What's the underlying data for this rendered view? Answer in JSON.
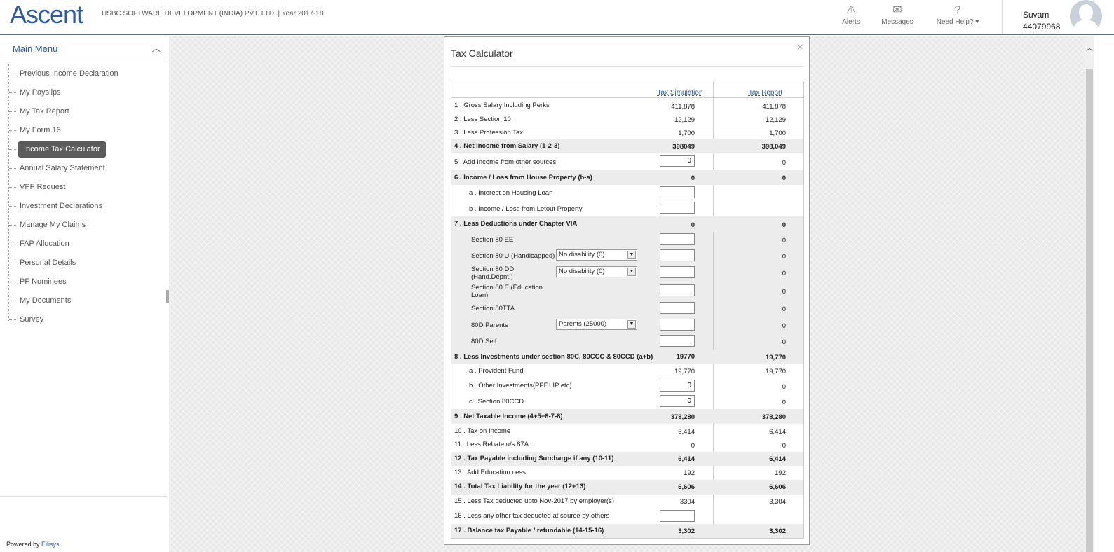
{
  "header": {
    "logo": "Ascent",
    "company": "HSBC SOFTWARE DEVELOPMENT (INDIA) PVT. LTD. | Year 2017-18",
    "alerts_label": "Alerts",
    "messages_label": "Messages",
    "help_label": "Need Help? ▾",
    "user_name": "Suvam",
    "user_id": "44079968",
    "icons": [
      "warning-icon",
      "mail-icon",
      "question-icon",
      "avatar-icon"
    ]
  },
  "sidebar": {
    "title": "Main Menu",
    "items": [
      {
        "label": "Previous Income Declaration"
      },
      {
        "label": "My Payslips"
      },
      {
        "label": "My Tax Report"
      },
      {
        "label": "My Form 16"
      },
      {
        "label": "Income Tax Calculator",
        "active": true
      },
      {
        "label": "Annual Salary Statement"
      },
      {
        "label": "VPF Request"
      },
      {
        "label": "Investment Declarations"
      },
      {
        "label": "Manage My Claims"
      },
      {
        "label": "FAP Allocation"
      },
      {
        "label": "Personal Details"
      },
      {
        "label": "PF Nominees"
      },
      {
        "label": "My Documents"
      },
      {
        "label": "Survey"
      }
    ],
    "powered_prefix": "Powered by",
    "powered_link": "Eilisys"
  },
  "modal": {
    "title": "Tax Calculator",
    "close": "×",
    "col1": "Tax Simulation",
    "col2": "Tax Report",
    "rows": {
      "r1": {
        "label": "1 . Gross Salary Including Perks",
        "v1": "411,878",
        "v2": "411,878"
      },
      "r2": {
        "label": "2 . Less Section 10",
        "v1": "12,129",
        "v2": "12,129"
      },
      "r3": {
        "label": "3 . Less Profession Tax",
        "v1": "1,700",
        "v2": "1,700"
      },
      "r4": {
        "label": "4 . Net Income from Salary (1-2-3)",
        "v1": "398049",
        "v2": "398,049"
      },
      "r5": {
        "label": "5 . Add Income from other sources",
        "input": "0",
        "v2": "0"
      },
      "r6": {
        "label": "6 . Income / Loss from House Property (b-a)",
        "v1": "0",
        "v2": "0"
      },
      "r6a": {
        "label": "a . Interest on Housing Loan",
        "input": ""
      },
      "r6b": {
        "label": "b . Income / Loss from Letout Property",
        "input": ""
      },
      "r7": {
        "label": "7 . Less Deductions under Chapter VIA",
        "v1": "0",
        "v2": "0"
      },
      "s80ee": {
        "label": "Section 80 EE",
        "input": "",
        "v2": "0"
      },
      "s80u": {
        "label": "Section 80 U (Handicapped)",
        "select": "No disability (0)",
        "input": "",
        "v2": "0"
      },
      "s80dd": {
        "label": "Section 80 DD (Hand.Depnt.)",
        "select": "No disability (0)",
        "input": "",
        "v2": "0"
      },
      "s80e": {
        "label": "Section 80 E (Education Loan)",
        "input": "",
        "v2": "0"
      },
      "s80tta": {
        "label": "Section 80TTA",
        "input": "",
        "v2": "0"
      },
      "s80dp": {
        "label": "80D Parents",
        "select": "Parents (25000)",
        "input": "",
        "v2": "0"
      },
      "s80ds": {
        "label": "80D Self",
        "input": "",
        "v2": "0"
      },
      "r8": {
        "label": "8 . Less Investments under section 80C, 80CCC & 80CCD (a+b)",
        "v1": "19770",
        "v2": "19,770"
      },
      "r8a": {
        "label": "a . Provident Fund",
        "v1": "19,770",
        "v2": "19,770"
      },
      "r8b": {
        "label": "b . Other Investments(PPF,LIP etc)",
        "input": "0",
        "v2": "0"
      },
      "r8c": {
        "label": "c . Section 80CCD",
        "input": "0",
        "v2": "0"
      },
      "r9": {
        "label": "9 . Net Taxable Income (4+5+6-7-8)",
        "v1": "378,280",
        "v2": "378,280"
      },
      "r10": {
        "label": "10 . Tax on Income",
        "v1": "6,414",
        "v2": "6,414"
      },
      "r11": {
        "label": "11 . Less Rebate u/s 87A",
        "v1": "0",
        "v2": "0"
      },
      "r12": {
        "label": "12 . Tax Payable including Surcharge if any (10-11)",
        "v1": "6,414",
        "v2": "6,414"
      },
      "r13": {
        "label": "13 . Add Education cess",
        "v1": "192",
        "v2": "192"
      },
      "r14": {
        "label": "14 . Total Tax Liability for the year (12+13)",
        "v1": "6,606",
        "v2": "6,606"
      },
      "r15": {
        "label": "15 . Less Tax deducted upto Nov-2017 by employer(s)",
        "v1": "3304",
        "v2": "3,304"
      },
      "r16": {
        "label": "16 . Less any other tax deducted at source by others",
        "input": ""
      },
      "r17": {
        "label": "17 . Balance tax Payable / refundable (14-15-16)",
        "v1": "3,302",
        "v2": "3,302"
      }
    }
  }
}
